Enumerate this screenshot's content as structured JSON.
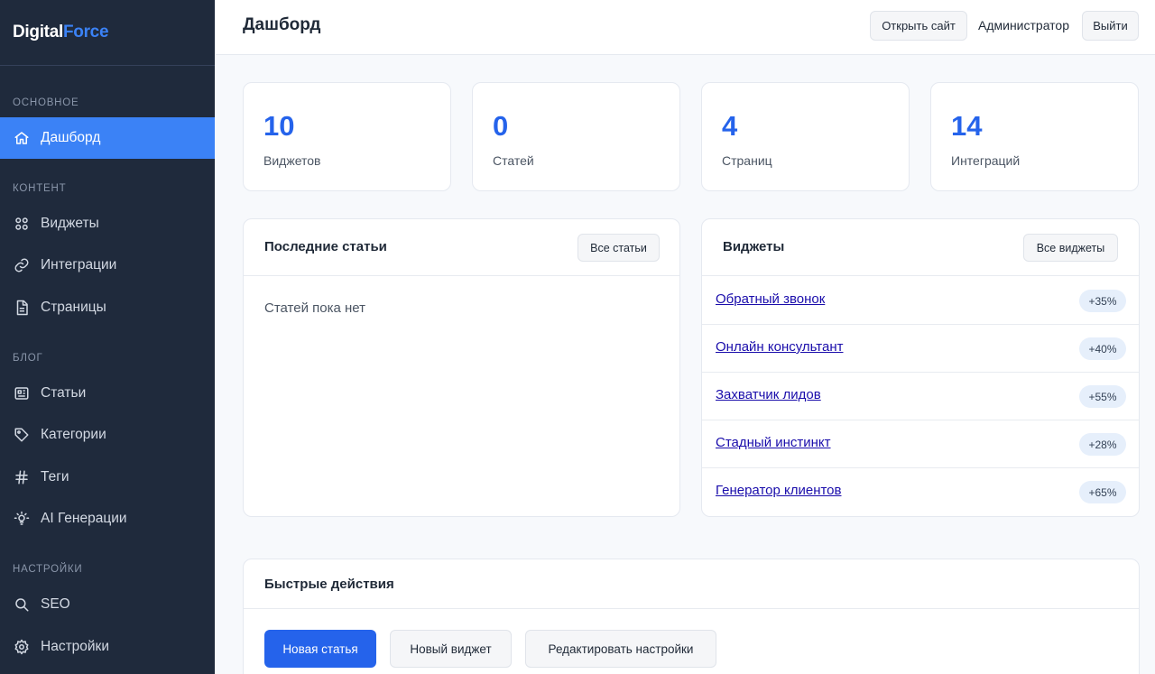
{
  "brand": {
    "part1": "Digital",
    "part2": "Force"
  },
  "sidebar": {
    "sections": [
      {
        "title": "ОСНОВНОЕ"
      },
      {
        "title": "КОНТЕНТ"
      },
      {
        "title": "БЛОГ"
      },
      {
        "title": "НАСТРОЙКИ"
      }
    ],
    "items": [
      {
        "label": "Дашборд",
        "icon": "home-icon",
        "active": true
      },
      {
        "label": "Виджеты",
        "icon": "grid-icon"
      },
      {
        "label": "Интеграции",
        "icon": "link-icon"
      },
      {
        "label": "Страницы",
        "icon": "file-icon"
      },
      {
        "label": "Статьи",
        "icon": "newspaper-icon"
      },
      {
        "label": "Категории",
        "icon": "tag-icon"
      },
      {
        "label": "Теги",
        "icon": "hash-icon"
      },
      {
        "label": "AI Генерации",
        "icon": "lightbulb-icon"
      },
      {
        "label": "SEO",
        "icon": "search-icon"
      },
      {
        "label": "Настройки",
        "icon": "gear-icon"
      }
    ]
  },
  "header": {
    "title": "Дашборд",
    "open_site": "Открыть сайт",
    "user": "Администратор",
    "logout": "Выйти"
  },
  "stats": [
    {
      "value": "10",
      "label": "Виджетов"
    },
    {
      "value": "0",
      "label": "Статей"
    },
    {
      "value": "4",
      "label": "Страниц"
    },
    {
      "value": "14",
      "label": "Интеграций"
    }
  ],
  "articles_panel": {
    "title": "Последние статьи",
    "button": "Все статьи",
    "empty": "Статей пока нет"
  },
  "widgets_panel": {
    "title": "Виджеты",
    "button": "Все виджеты",
    "items": [
      {
        "name": "Обратный звонок",
        "badge": "+35%"
      },
      {
        "name": "Онлайн консультант",
        "badge": "+40%"
      },
      {
        "name": "Захватчик лидов",
        "badge": "+55%"
      },
      {
        "name": "Стадный инстинкт",
        "badge": "+28%"
      },
      {
        "name": "Генератор клиентов",
        "badge": "+65%"
      }
    ]
  },
  "quick_actions": {
    "title": "Быстрые действия",
    "new_article": "Новая статья",
    "new_widget": "Новый виджет",
    "edit_settings": "Редактировать настройки"
  },
  "colors": {
    "accent": "#3b82f6",
    "sidebar_bg": "#1f2a3c",
    "stat_value": "#2563eb"
  }
}
